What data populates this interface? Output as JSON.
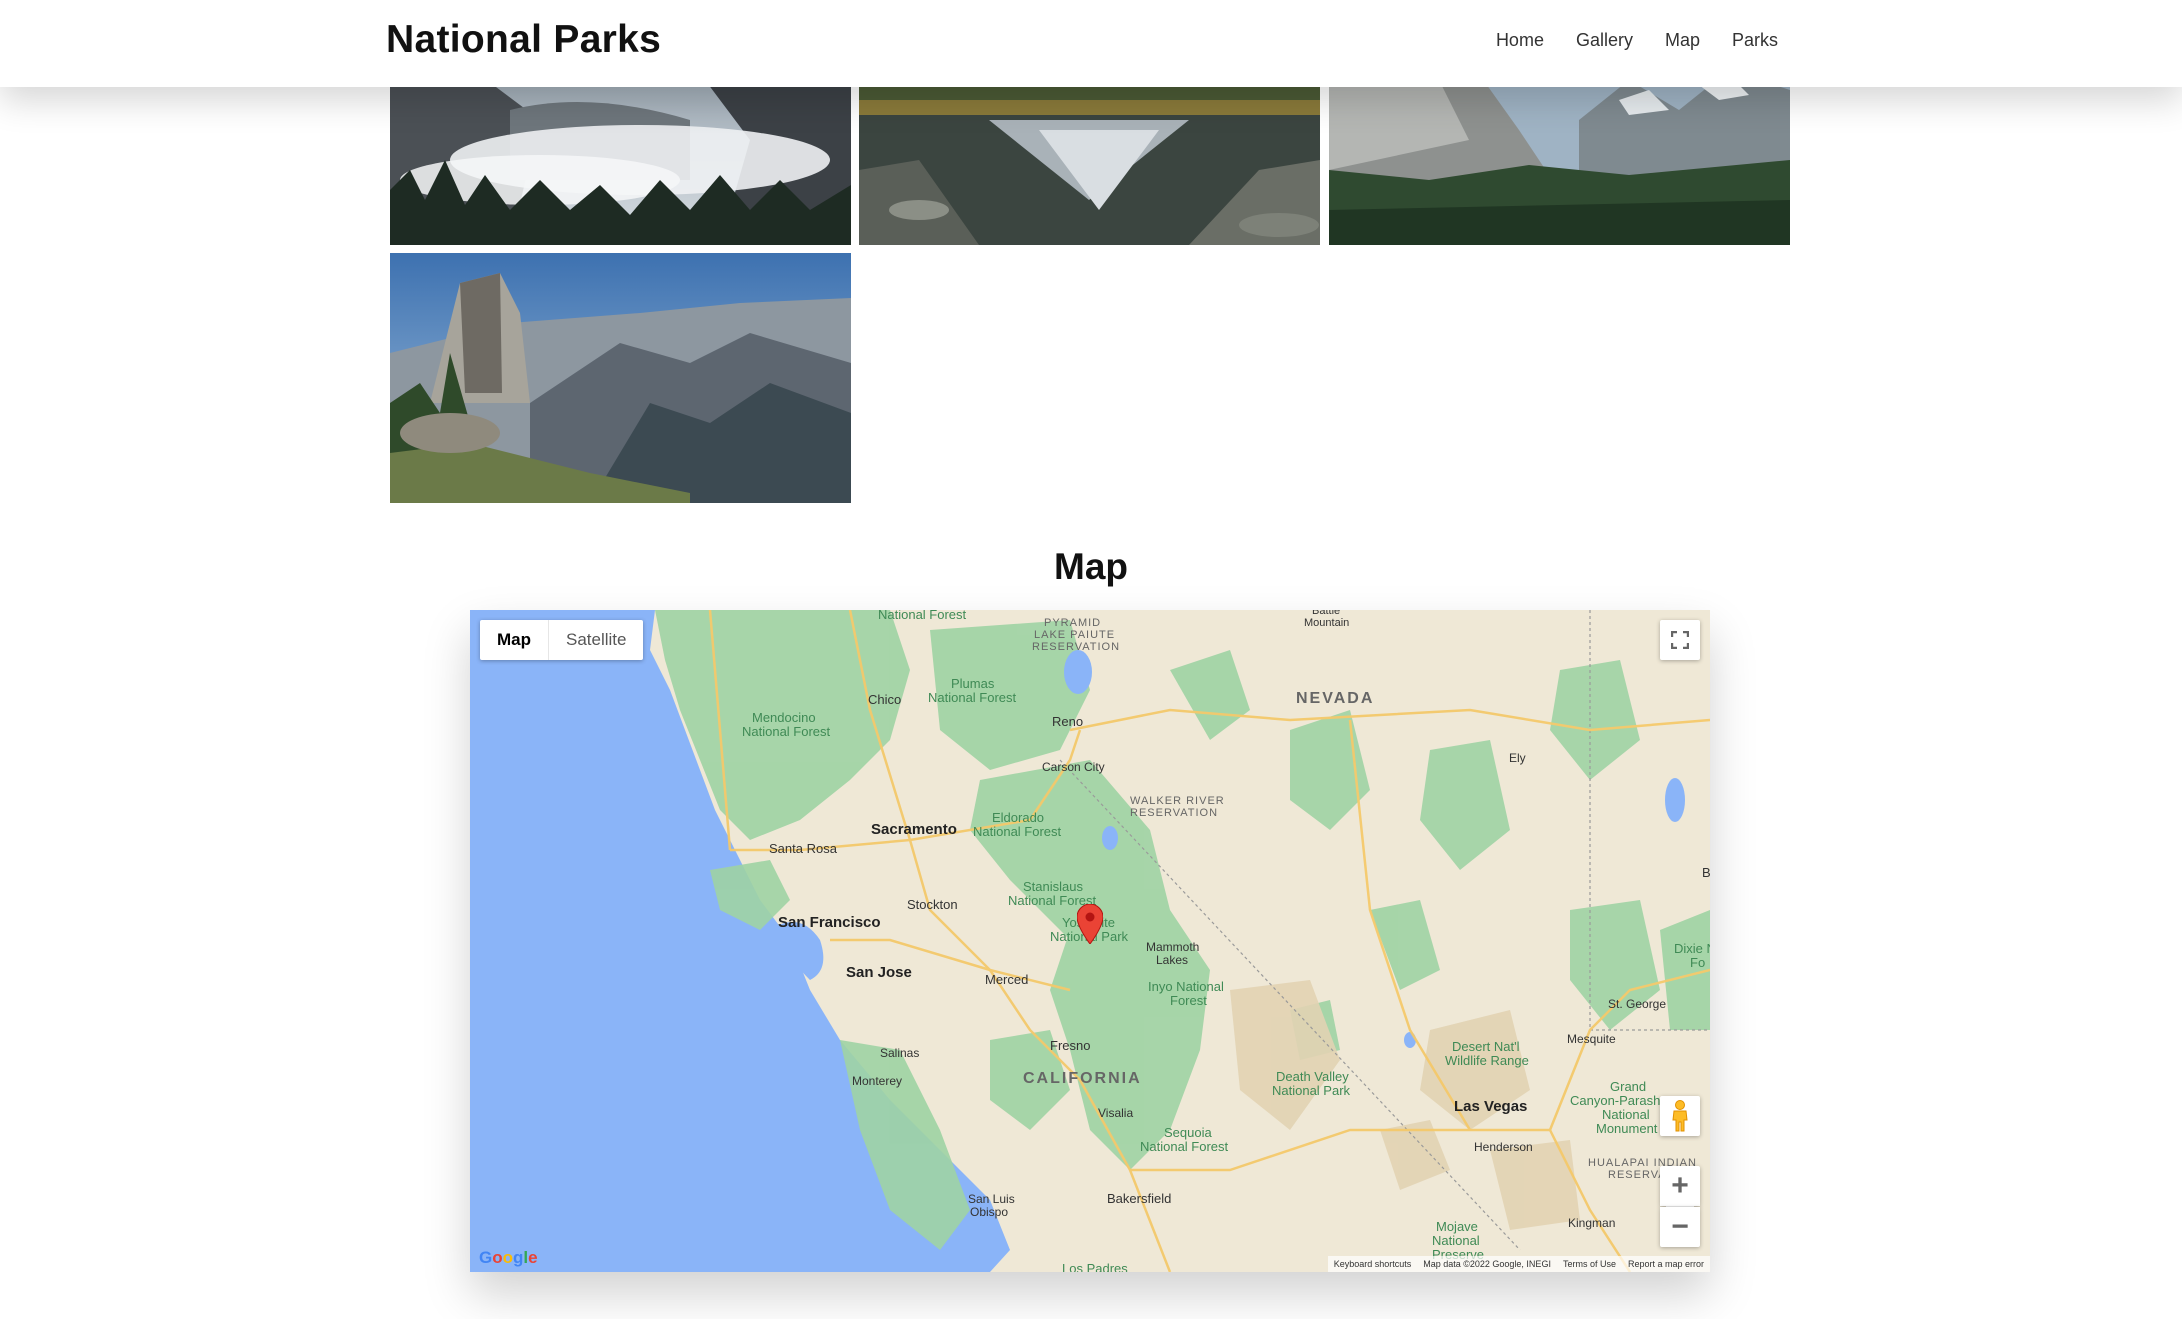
{
  "header": {
    "brand": "National Parks",
    "nav": [
      "Home",
      "Gallery",
      "Map",
      "Parks"
    ]
  },
  "gallery": {
    "images": [
      "misty-valley-photo",
      "reflection-pond-photo",
      "tunnel-view-photo",
      "half-dome-vista-photo"
    ]
  },
  "map_section": {
    "title": "Map",
    "map_type": {
      "map": "Map",
      "satellite": "Satellite"
    },
    "controls": {
      "fullscreen": "fullscreen-icon",
      "street_view": "pegman-icon",
      "zoom_in": "+",
      "zoom_out": "−"
    },
    "logo": "Google",
    "attribution": [
      "Keyboard shortcuts",
      "Map data ©2022 Google, INEGI",
      "Terms of Use",
      "Report a map error"
    ],
    "labels": {
      "national_forest_top": "National Forest",
      "pyramid": "PYRAMID",
      "lake_paiute": "LAKE PAIUTE",
      "reservation": "RESERVATION",
      "battle_mountain_1": "Battle",
      "battle_mountain_2": "Mountain",
      "nevada": "NEVADA",
      "chico": "Chico",
      "plumas_1": "Plumas",
      "plumas_2": "National Forest",
      "mendocino_1": "Mendocino",
      "mendocino_2": "National Forest",
      "reno": "Reno",
      "carson_city": "Carson City",
      "ely": "Ely",
      "walker_1": "WALKER RIVER",
      "walker_2": "RESERVATION",
      "eldorado_1": "Eldorado",
      "eldorado_2": "National Forest",
      "sacramento": "Sacramento",
      "santa_rosa": "Santa Rosa",
      "stanislaus_1": "Stanislaus",
      "stanislaus_2": "National Forest",
      "san_francisco": "San Francisco",
      "stockton": "Stockton",
      "yosemite_1": "Yosemite",
      "yosemite_2": "National Park",
      "mammoth_1": "Mammoth",
      "mammoth_2": "Lakes",
      "b_edge": "B",
      "dixie_1": "Dixie N",
      "dixie_2": "Fo",
      "san_jose": "San Jose",
      "merced": "Merced",
      "inyo_1": "Inyo National",
      "inyo_2": "Forest",
      "st_george": "St. George",
      "fresno": "Fresno",
      "desert_1": "Desert Nat'l",
      "desert_2": "Wildlife Range",
      "mesquite": "Mesquite",
      "salinas": "Salinas",
      "california": "CALIFORNIA",
      "death_valley_1": "Death Valley",
      "death_valley_2": "National Park",
      "monterey": "Monterey",
      "grand_canyon_1": "Grand",
      "grand_canyon_2": "Canyon-Parashant",
      "grand_canyon_3": "National",
      "grand_canyon_4": "Monument",
      "las_vegas": "Las Vegas",
      "visalia": "Visalia",
      "sequoia_1": "Sequoia",
      "sequoia_2": "National Forest",
      "henderson": "Henderson",
      "hualapai_1": "HUALAPAI INDIAN",
      "hualapai_2": "RESERVATION",
      "san_luis_1": "San Luis",
      "san_luis_2": "Obispo",
      "bakersfield": "Bakersfield",
      "mojave_1": "Mojave",
      "mojave_2": "National",
      "mojave_3": "Preserve",
      "kingman": "Kingman",
      "los_padres": "Los Padres"
    }
  }
}
